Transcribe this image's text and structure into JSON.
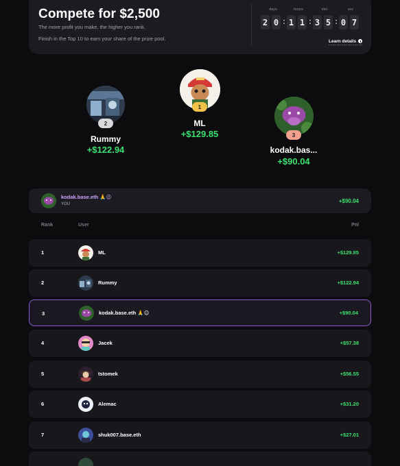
{
  "hero": {
    "title": "Compete for $2,500",
    "subtitle": "The more profit you make, the higher you rank.",
    "subtitle2": "Finish in the Top 10 to earn your share of the prize pool.",
    "countdown": {
      "labels": [
        "days",
        "hours",
        "min",
        "sec"
      ],
      "digits": [
        "2",
        "0",
        "1",
        "1",
        "3",
        "5",
        "0",
        "7"
      ]
    },
    "learn_label": "Learn details"
  },
  "podium": [
    {
      "rank": "2",
      "name": "Rummy",
      "pnl": "+$122.94",
      "badge_color": "#d9d9dc"
    },
    {
      "rank": "1",
      "name": "ML",
      "pnl": "+$129.85",
      "badge_color": "#f3c04a"
    },
    {
      "rank": "3",
      "name": "kodak.bas...",
      "pnl": "+$90.04",
      "badge_color": "#f0a08c"
    }
  ],
  "you": {
    "name": "kodak.base.eth 🙏😉",
    "tag": "YOU",
    "pnl": "+$90.04"
  },
  "table": {
    "headers": {
      "rank": "Rank",
      "user": "User",
      "pnl": "Pnl"
    },
    "rows": [
      {
        "rank": "1",
        "name": "ML",
        "pnl": "+$129.85",
        "avatar": "ml-avatar"
      },
      {
        "rank": "2",
        "name": "Rummy",
        "pnl": "+$122.94",
        "avatar": "rummy-avatar"
      },
      {
        "rank": "3",
        "name": "kodak.base.eth 🙏😉",
        "pnl": "+$90.04",
        "avatar": "kodak-avatar"
      },
      {
        "rank": "4",
        "name": "Jacek",
        "pnl": "+$57.38",
        "avatar": "jacek-avatar"
      },
      {
        "rank": "5",
        "name": "tstomek",
        "pnl": "+$56.55",
        "avatar": "tstomek-avatar"
      },
      {
        "rank": "6",
        "name": "Alemac",
        "pnl": "+$31.20",
        "avatar": "alemac-avatar"
      },
      {
        "rank": "7",
        "name": "shuk007.base.eth",
        "pnl": "+$27.01",
        "avatar": "shuk-avatar"
      }
    ]
  },
  "colors": {
    "accent_green": "#3be26f",
    "highlight_border": "#8c5bd6",
    "you_name": "#c9a6ff"
  }
}
